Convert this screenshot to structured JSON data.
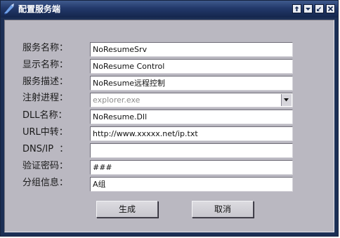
{
  "window": {
    "title": "配置服务端"
  },
  "form": {
    "fields": [
      {
        "label": "服务名称：",
        "value": "NoResumeSrv"
      },
      {
        "label": "显示名称：",
        "value": "NoResume Control"
      },
      {
        "label": "服务描述：",
        "value": "NoResume远程控制"
      },
      {
        "label": "注射进程：",
        "value": "explorer.exe"
      },
      {
        "label": "DLL名称：",
        "value": "NoResume.Dll"
      },
      {
        "label": "URL中转：",
        "value": "http://www.xxxxx.net/ip.txt"
      },
      {
        "label": "DNS/IP  ：",
        "value": ""
      },
      {
        "label": "验证密码：",
        "value": "###"
      },
      {
        "label": "分组信息：",
        "value": "A组"
      }
    ]
  },
  "buttons": {
    "generate": "生成",
    "cancel": "取消"
  },
  "icons": {
    "app": "blue-arrow-icon",
    "pin": "pin-icon",
    "minimize": "minimize-icon",
    "restore": "restore-icon",
    "close": "close-icon",
    "dropdown": "chevron-down-icon"
  },
  "colors": {
    "titlebar": "#22386a",
    "client_bg": "#bab8c1",
    "title_text": "#ffffff"
  }
}
